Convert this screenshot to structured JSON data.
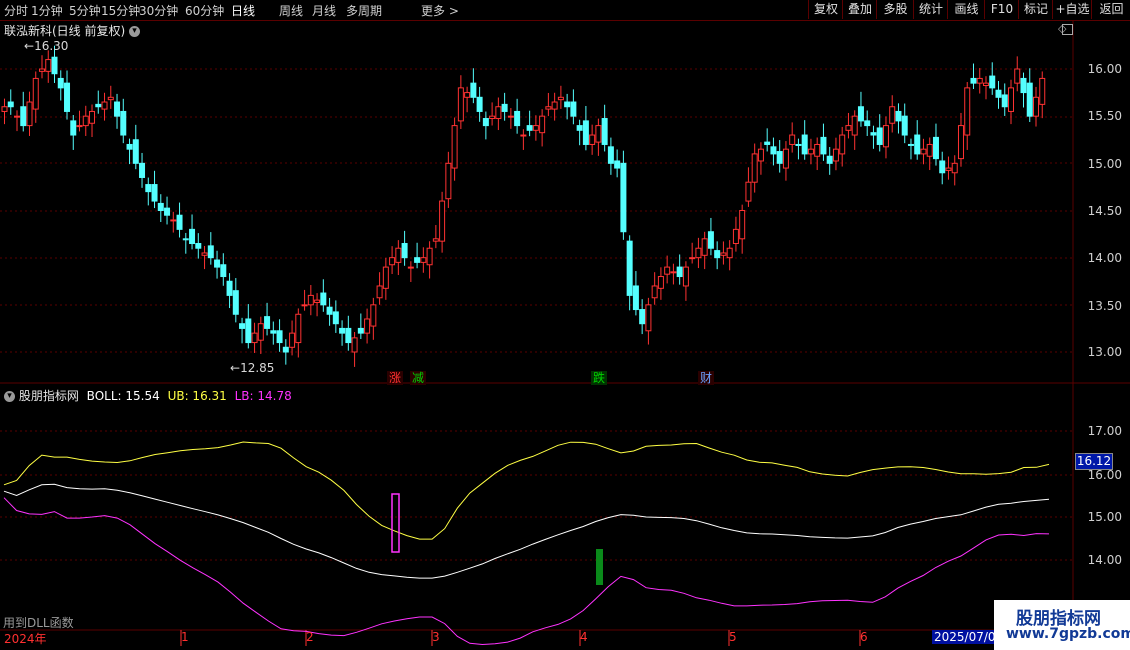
{
  "toolbar": {
    "periods": [
      "分时",
      "1分钟",
      "5分钟",
      "15分钟",
      "30分钟",
      "60分钟",
      "日线",
      "周线",
      "月线",
      "多周期",
      "更多 >"
    ],
    "active_period": "日线",
    "right_buttons": [
      "复权",
      "叠加",
      "多股",
      "统计",
      "画线",
      "F10",
      "标记",
      "+自选",
      "返回"
    ]
  },
  "main_panel": {
    "title": "联泓新科(日线 前复权)",
    "high_marker": "16.30",
    "low_marker": "12.85",
    "price_axis": [
      "16.00",
      "15.50",
      "15.00",
      "14.50",
      "14.00",
      "13.50",
      "13.00"
    ],
    "events": [
      {
        "text": "涨",
        "color": "#ff3030"
      },
      {
        "text": "减",
        "color": "#00d000"
      },
      {
        "text": "跌",
        "color": "#00d000"
      },
      {
        "text": "财",
        "color": "#6aa0ff"
      }
    ],
    "colors": {
      "up": "#ff3232",
      "down": "#54ffff",
      "grid": "#5a0000"
    }
  },
  "indicator_panel": {
    "name": "股朋指标网",
    "boll_label": "BOLL: 15.54",
    "ub_label": "UB: 16.31",
    "lb_label": "LB: 14.78",
    "axis": [
      "17.00",
      "16.00",
      "15.00",
      "14.00"
    ],
    "current_value": "16.12",
    "colors": {
      "mid": "#ffffff",
      "ub": "#ffff44",
      "lb": "#ff33ff"
    }
  },
  "time_axis": {
    "labels": [
      "2024年",
      "1",
      "2",
      "3",
      "4",
      "5",
      "6",
      "2025/07/0"
    ]
  },
  "footer_note": "用到DLL函数",
  "watermark": {
    "title": "股朋指标网",
    "url": "www.7gpzb.com"
  },
  "chart_data": {
    "type": "candlestick",
    "title": "联泓新科(日线 前复权)",
    "ylim": [
      12.7,
      16.35
    ],
    "ohlc_close_trend": [
      15.6,
      15.4,
      15.9,
      16.1,
      15.8,
      15.3,
      15.5,
      15.6,
      15.7,
      15.3,
      15.0,
      14.7,
      14.5,
      14.4,
      14.2,
      14.1,
      14.0,
      13.8,
      13.4,
      13.1,
      13.3,
      13.2,
      13.0,
      13.4,
      13.6,
      13.5,
      13.3,
      13.1,
      13.2,
      13.5,
      13.9,
      14.1,
      13.9,
      14.0,
      14.2,
      15.0,
      15.8,
      15.7,
      15.4,
      15.6,
      15.5,
      15.3,
      15.4,
      15.6,
      15.7,
      15.5,
      15.2,
      15.4,
      15.0,
      14.9,
      13.6,
      13.3,
      13.7,
      13.9,
      13.8,
      14.0,
      14.2,
      14.0,
      14.1,
      14.5,
      15.1,
      15.2,
      15.0,
      15.3,
      15.1,
      15.2,
      15.0,
      15.3,
      15.5,
      15.4,
      15.2,
      15.6,
      15.3,
      15.1,
      15.2,
      14.9,
      15.0,
      15.8,
      15.9,
      15.8,
      15.6,
      16.0,
      15.5,
      15.9
    ],
    "indicator": {
      "type": "line",
      "series": [
        {
          "name": "BOLL",
          "last": 15.54
        },
        {
          "name": "UB",
          "last": 16.31
        },
        {
          "name": "LB",
          "last": 14.78
        }
      ],
      "ylim": [
        13.0,
        17.9
      ]
    },
    "legend": "top-left"
  }
}
